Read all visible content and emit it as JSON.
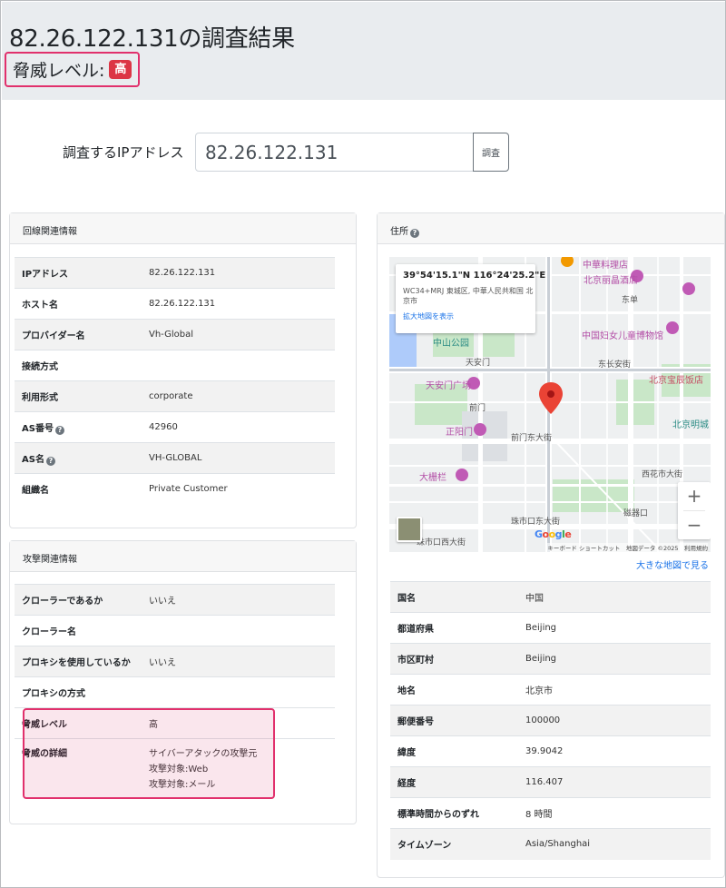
{
  "header": {
    "title": "82.26.122.131の調査結果",
    "threat_label": "脅威レベル:",
    "threat_badge": "高",
    "badge_color": "#dc3545",
    "highlight_color": "#e1306c"
  },
  "search": {
    "label": "調査するIPアドレス",
    "value": "82.26.122.131",
    "button_label": "調査"
  },
  "line_info": {
    "title": "回線関連情報",
    "rows": [
      {
        "key": "IPアドレス",
        "value": "82.26.122.131"
      },
      {
        "key": "ホスト名",
        "value": "82.26.122.131"
      },
      {
        "key": "プロバイダー名",
        "value": "Vh-Global"
      },
      {
        "key": "接続方式",
        "value": ""
      },
      {
        "key": "利用形式",
        "value": "corporate"
      },
      {
        "key": "AS番号",
        "value": "42960"
      },
      {
        "key": "AS名",
        "value": "VH-GLOBAL"
      },
      {
        "key": "組織名",
        "value": "Private Customer"
      }
    ]
  },
  "attack_info": {
    "title": "攻撃関連情報",
    "rows": [
      {
        "key": "クローラーであるか",
        "value": "いいえ"
      },
      {
        "key": "クローラー名",
        "value": ""
      },
      {
        "key": "プロキシを使用しているか",
        "value": "いいえ"
      },
      {
        "key": "プロキシの方式",
        "value": ""
      },
      {
        "key": "脅威レベル",
        "value": "高"
      },
      {
        "key": "脅威の詳細",
        "lines": [
          "サイバーアタックの攻撃元",
          "攻撃対象:Web",
          "攻撃対象:メール"
        ]
      }
    ]
  },
  "address": {
    "title": "住所",
    "map": {
      "coords": "39°54'15.1\"N 116°24'25.2\"E",
      "plus_code": "WC34+MRJ 東城区, 中華人民共和国 北京市",
      "enlarge_link": "拡大地図を表示",
      "zoom_in": "+",
      "zoom_out": "−",
      "footer": "キーボード ショートカット　地図データ ©2025　利用規約",
      "labels": {
        "zhonghua": "中華料理店",
        "beijing_hotel": "北京丽晶酒店",
        "dongdan": "东单",
        "zhongshan_park": "中山公园",
        "women_museum": "中国妇女儿童博物馆",
        "tiananmen": "天安门",
        "tiananmen_square": "天安门广场",
        "zhengyangmen": "正阳门",
        "qianmen": "前门",
        "dashilan": "大栅栏",
        "beijing_mingcheng": "北京明城",
        "beijing_baochen": "北京宝辰饭店",
        "xihuashi": "西花市大街",
        "qianmen_east": "前门东大街",
        "cishikou": "珠市口东大街",
        "cishikou_west": "珠市口西大街",
        "dongchang": "东长安街",
        "cigai": "磁器口"
      }
    },
    "bigmap_link": "大きな地図で見る",
    "rows": [
      {
        "key": "国名",
        "value": "中国"
      },
      {
        "key": "都道府県",
        "value": "Beijing"
      },
      {
        "key": "市区町村",
        "value": "Beijing"
      },
      {
        "key": "地名",
        "value": "北京市"
      },
      {
        "key": "郵便番号",
        "value": "100000"
      },
      {
        "key": "緯度",
        "value": "39.9042"
      },
      {
        "key": "経度",
        "value": "116.407"
      },
      {
        "key": "標準時間からのずれ",
        "value": "8 時間"
      },
      {
        "key": "タイムゾーン",
        "value": "Asia/Shanghai"
      }
    ]
  }
}
